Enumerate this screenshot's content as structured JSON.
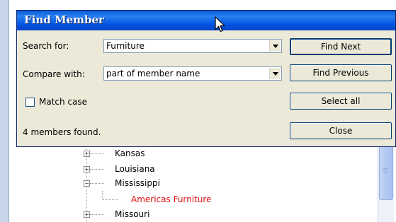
{
  "dialog": {
    "title": "Find Member",
    "search_label": "Search for:",
    "search_value": "Furniture",
    "compare_label": "Compare with:",
    "compare_value": "part of member name",
    "match_case_label": "Match case",
    "match_case_checked": false,
    "status": "4 members found.",
    "buttons": {
      "find_next": "Find Next",
      "find_previous": "Find Previous",
      "select_all": "Select all",
      "close": "Close"
    }
  },
  "tree": {
    "items": [
      {
        "label": "Kansas",
        "expander": "+"
      },
      {
        "label": "Louisiana",
        "expander": "+"
      },
      {
        "label": "Mississippi",
        "expander": "−"
      },
      {
        "label": "Americas Furniture",
        "highlight_color": "#e01010"
      },
      {
        "label": "Missouri",
        "expander": "+"
      }
    ]
  },
  "colors": {
    "titlebar": "#0054e3",
    "dialog_bg": "#ece9d8",
    "highlight": "#e01010"
  }
}
